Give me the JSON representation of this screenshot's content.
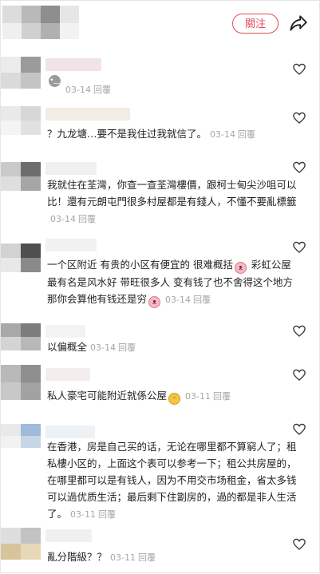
{
  "header": {
    "follow_label": "關注",
    "share_icon": "share-arrow-icon",
    "accent": "#e24c5a"
  },
  "comments": [
    {
      "text": "",
      "emoji": "gray-face",
      "date": "03-14",
      "reply": "回覆"
    },
    {
      "text": "？九龙塘…要不是我住过我就信了。",
      "date": "03-14",
      "reply": "回覆"
    },
    {
      "text": "我就住在荃灣，你查一查荃灣樓價，跟柯士甸尖沙咀可以比！還有元朗屯門很多村屋都是有錢人，不懂不要亂標籤",
      "date": "03-14",
      "reply": "回覆"
    },
    {
      "text_a": "一个区附近 有贵的小区有便宜的 很难概括",
      "text_b": " 彩虹公屋最有名是风水好 带旺很多人 变有钱了也不舍得这个地方 那你会算他有钱还是穷",
      "emoji": "pig",
      "date": "03-14",
      "reply": "回覆"
    },
    {
      "text": "以偏概全",
      "date": "03-14",
      "reply": "回覆"
    },
    {
      "text": "私人豪宅可能附近就係公屋",
      "emoji": "grin",
      "date": "03-11",
      "reply": "回覆"
    },
    {
      "text": "在香港，房是自己买的话，无论在哪里都不算窮人了；租私樓小区的，上面这个表可以参考一下；租公共房屋的，在哪里都可以是有钱人，因为不用交市场租金，省太多钱可以過优质生活；最后剩下住劏房的，過的都是非人生活了。",
      "date": "03-11",
      "reply": "回覆"
    },
    {
      "text": "亂分階級？？",
      "date": "03-11",
      "reply": "回覆"
    }
  ],
  "heart_icon": "heart-outline-icon"
}
